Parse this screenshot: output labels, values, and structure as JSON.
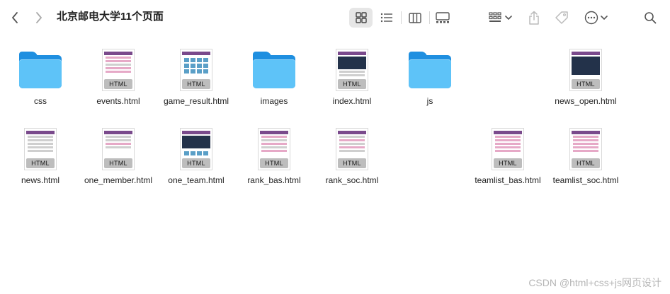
{
  "window": {
    "title": "北京邮电大学11个页面"
  },
  "toolbar": {
    "back_icon": "chevron-left-icon",
    "forward_icon": "chevron-right-icon",
    "views": [
      "icon-view",
      "list-view",
      "column-view",
      "gallery-view"
    ],
    "active_view": "icon-view",
    "actions": [
      "group-icon",
      "share-icon",
      "tag-icon",
      "more-icon",
      "search-icon"
    ]
  },
  "files": [
    {
      "name": "css",
      "kind": "folder"
    },
    {
      "name": "events.html",
      "kind": "html",
      "badge": "HTML",
      "preview": "table"
    },
    {
      "name": "game_result.html",
      "kind": "html",
      "badge": "HTML",
      "preview": "cells"
    },
    {
      "name": "images",
      "kind": "folder"
    },
    {
      "name": "index.html",
      "kind": "html",
      "badge": "HTML",
      "preview": "dark"
    },
    {
      "name": "js",
      "kind": "folder"
    },
    {
      "name": "news_open.html",
      "kind": "html",
      "badge": "HTML",
      "preview": "dark"
    },
    {
      "name": "news.html",
      "kind": "html",
      "badge": "HTML",
      "preview": "list"
    },
    {
      "name": "one_member.html",
      "kind": "html",
      "badge": "HTML",
      "preview": "profile"
    },
    {
      "name": "one_team.html",
      "kind": "html",
      "badge": "HTML",
      "preview": "dark"
    },
    {
      "name": "rank_bas.html",
      "kind": "html",
      "badge": "HTML",
      "preview": "table"
    },
    {
      "name": "rank_soc.html",
      "kind": "html",
      "badge": "HTML",
      "preview": "table"
    },
    {
      "name": "teamlist_bas.html",
      "kind": "html",
      "badge": "HTML",
      "preview": "table"
    },
    {
      "name": "teamlist_soc.html",
      "kind": "html",
      "badge": "HTML",
      "preview": "table"
    }
  ],
  "watermark": "CSDN @html+css+js网页设计",
  "colors": {
    "folder_front": "#5ec3f8",
    "folder_back": "#1f8fe0",
    "badge": "#bdbdbd",
    "preview_accent": "#7a4a8c"
  }
}
